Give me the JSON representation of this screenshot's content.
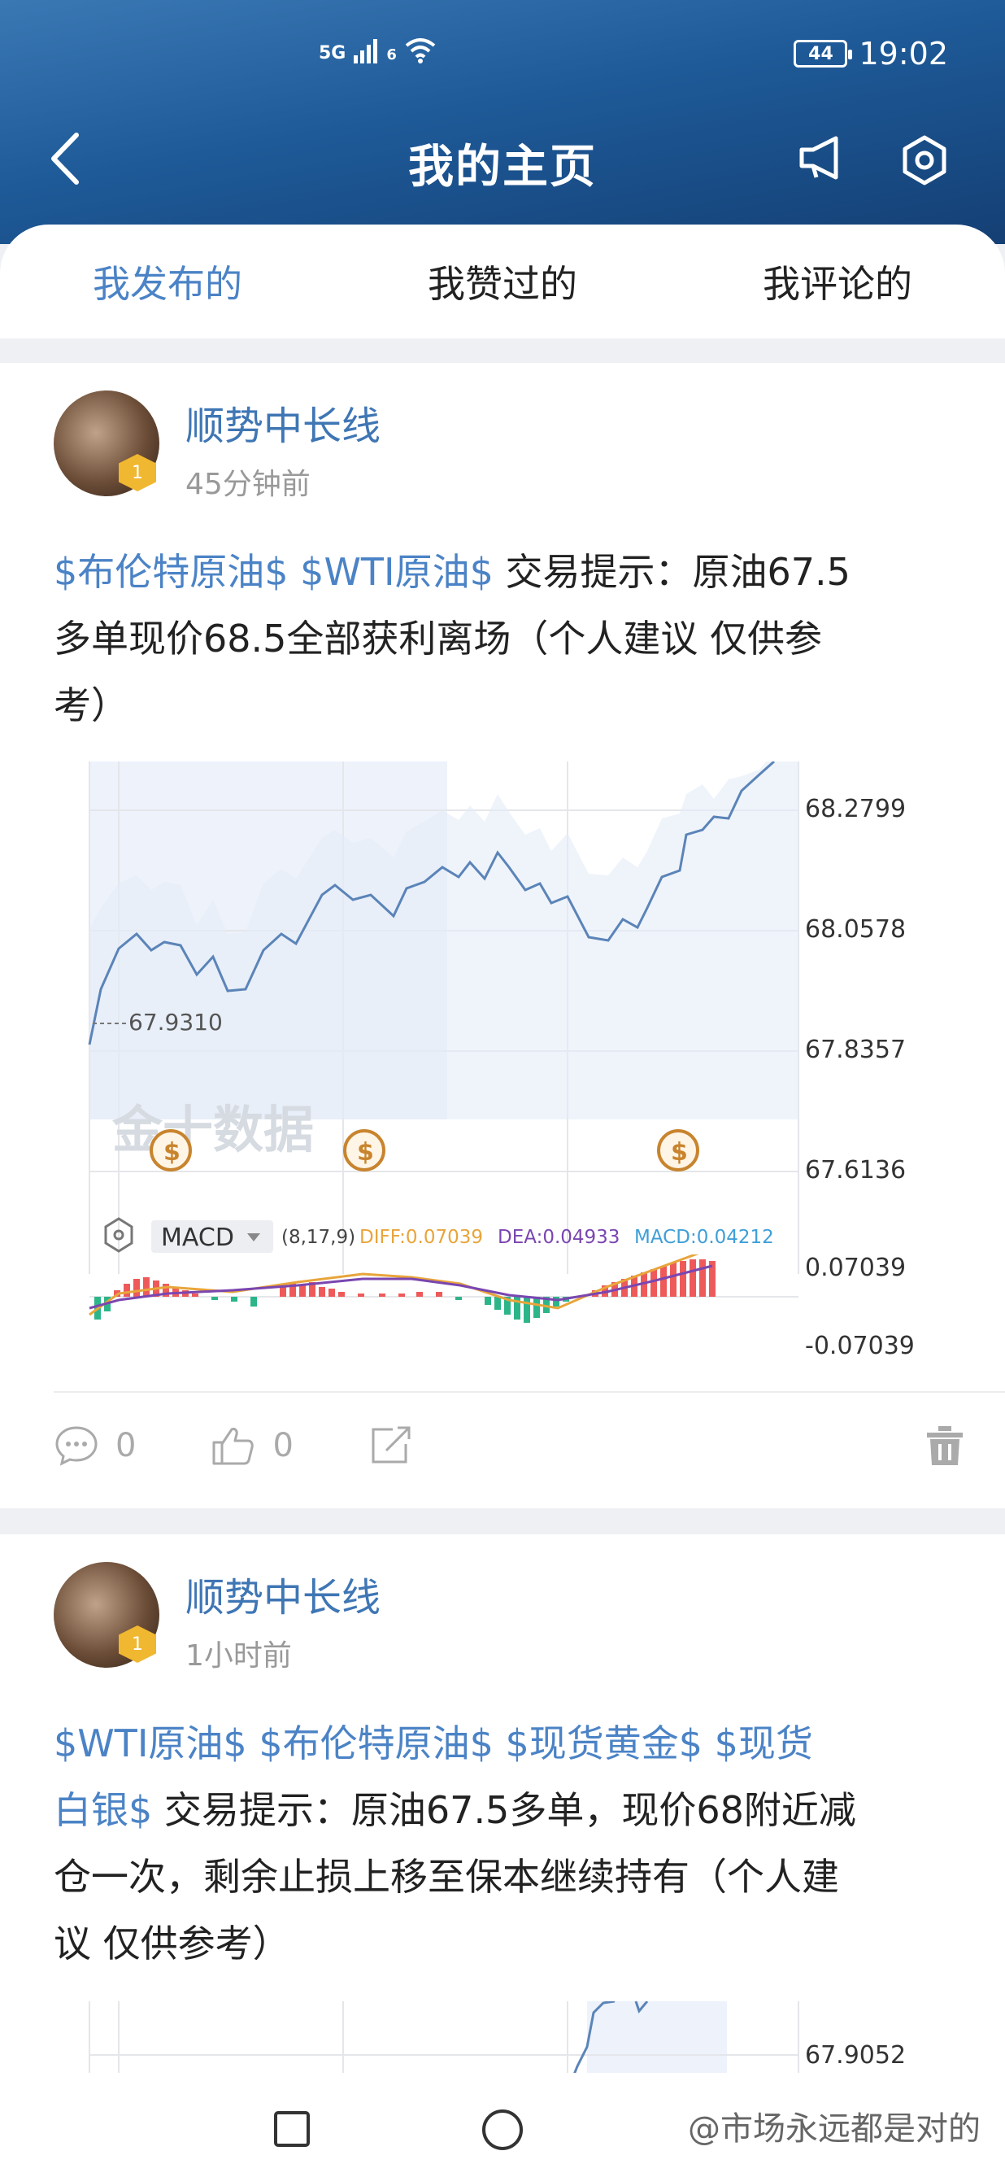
{
  "status_bar": {
    "network": "5G",
    "wifi_label": "6",
    "battery": "44",
    "time": "19:02"
  },
  "nav": {
    "title": "我的主页"
  },
  "tabs": [
    "我发布的",
    "我赞过的",
    "我评论的"
  ],
  "posts": [
    {
      "username": "顺势中长线",
      "time": "45分钟前",
      "badge": "1",
      "tags": [
        "$布伦特原油$",
        "$WTI原油$"
      ],
      "text_lines": [
        "交易提示：原油67.5",
        "多单现价68.5全部获利离场（个人建议 仅供参",
        "考）"
      ],
      "comments": "0",
      "likes": "0",
      "chart": {
        "price_axis": [
          "68.2799",
          "68.0578",
          "67.8357",
          "67.6136"
        ],
        "ref_label": "67.9310",
        "watermark": "金十数据",
        "macd_label": "MACD",
        "macd_params": "(8,17,9)",
        "diff": "DIFF:0.07039",
        "dea": "DEA:0.04933",
        "macd": "MACD:0.04212",
        "macd_axis": [
          "0.07039",
          "-0.07039"
        ]
      }
    },
    {
      "username": "顺势中长线",
      "time": "1小时前",
      "badge": "1",
      "tags": [
        "$WTI原油$",
        "$布伦特原油$",
        "$现货黄金$"
      ],
      "tag_split": [
        "$现货",
        "白银$"
      ],
      "text_lines": [
        "交易提示：原油67.5多单，现价68附近减",
        "仓一次，剩余止损上移至保本继续持有（个人建",
        "议 仅供参考）"
      ],
      "chart": {
        "price_axis": [
          "67.9052"
        ]
      }
    }
  ],
  "watermark_text": "@市场永远都是对的",
  "colors": {
    "accent": "#4b83c6",
    "username": "#3f76b4",
    "price_line": "#5b84b8",
    "macd_up": "#ee5a5a",
    "macd_down": "#2db58a",
    "diff_line": "#e8a53b",
    "dea_line": "#7a46b0"
  }
}
